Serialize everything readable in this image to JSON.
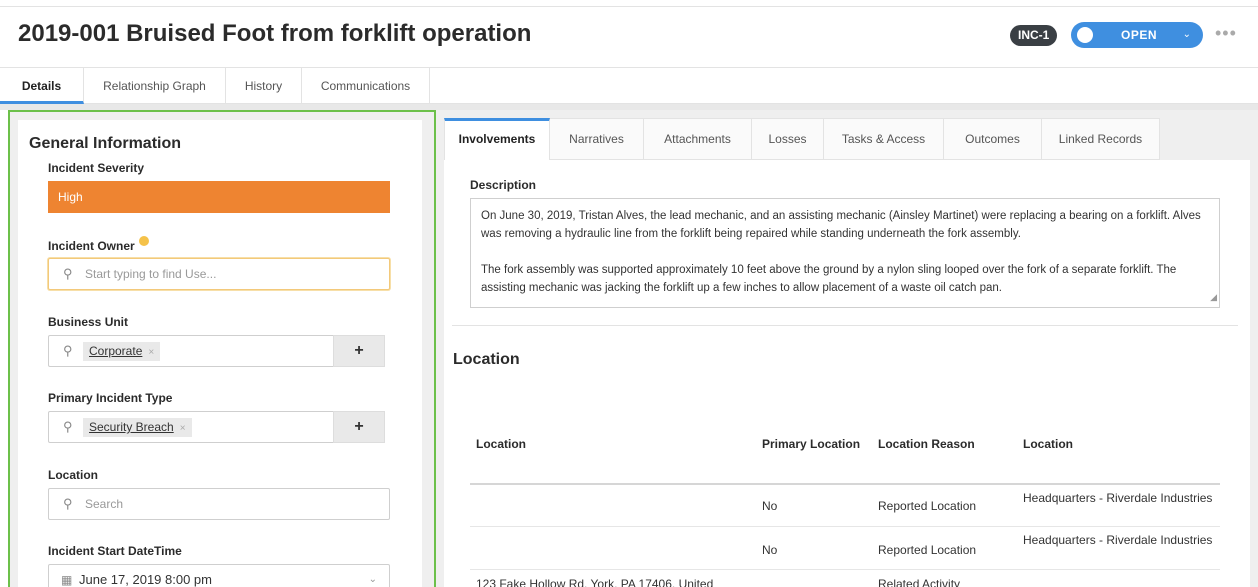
{
  "header": {
    "title": "2019-001 Bruised Foot from forklift operation",
    "badge": "INC-1",
    "status_label": "OPEN",
    "more_label": "•••"
  },
  "top_tabs": [
    "Details",
    "Relationship Graph",
    "History",
    "Communications"
  ],
  "general": {
    "title": "General Information",
    "severity_label": "Incident Severity",
    "severity_value": "High",
    "owner_label": "Incident Owner",
    "owner_placeholder": "Start typing to find Use...",
    "business_unit_label": "Business Unit",
    "business_unit_chip": "Corporate",
    "incident_type_label": "Primary Incident Type",
    "incident_type_chip": "Security Breach",
    "location_label": "Location",
    "location_placeholder": "Search",
    "start_label": "Incident Start DateTime",
    "start_value": "June 17, 2019 8:00 pm",
    "chip_remove": "×",
    "plus": "+"
  },
  "sub_tabs": [
    "Involvements",
    "Narratives",
    "Attachments",
    "Losses",
    "Tasks & Access",
    "Outcomes",
    "Linked Records"
  ],
  "description": {
    "label": "Description",
    "para1": "On June 30, 2019, Tristan Alves, the lead mechanic, and an assisting mechanic (Ainsley Martinet) were replacing a bearing on a forklift. Alves was removing a hydraulic line from the forklift being repaired while standing underneath the fork assembly.",
    "para2": "The fork assembly was supported approximately 10 feet above the ground by a nylon sling looped over the fork of a separate forklift. The assisting mechanic was jacking the forklift up a few inches to allow placement of a waste oil catch pan."
  },
  "location_section": {
    "heading": "Location",
    "columns": [
      "Location",
      "Primary Location",
      "Location Reason",
      "Location"
    ],
    "rows": [
      {
        "location": "",
        "primary": "No",
        "reason": "Reported Location",
        "site": "Headquarters - Riverdale Industries"
      },
      {
        "location": "",
        "primary": "No",
        "reason": "Reported Location",
        "site": "Headquarters - Riverdale Industries"
      },
      {
        "location": "123 Fake Hollow Rd, York, PA 17406, United",
        "primary": "",
        "reason": "Related Activity",
        "site": ""
      }
    ]
  },
  "colors": {
    "accent": "#3f8fe0",
    "severity_high": "#ee8431",
    "focus_outline": "#6cc04a"
  }
}
